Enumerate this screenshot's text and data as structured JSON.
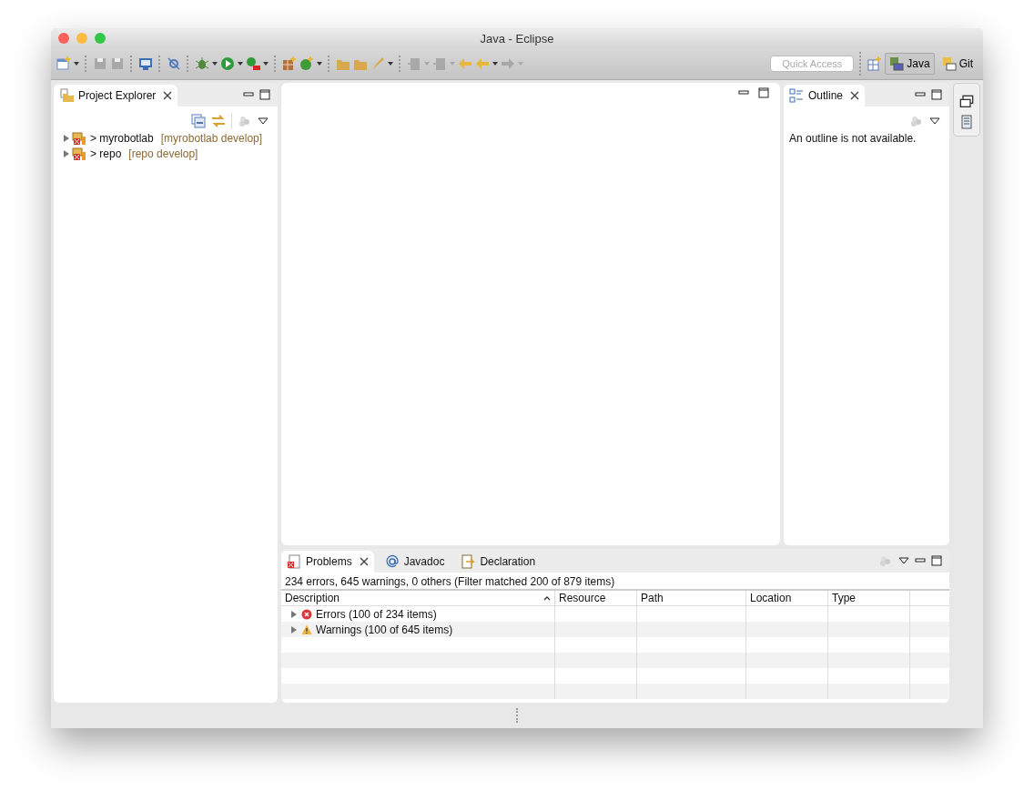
{
  "window": {
    "title": "Java - Eclipse"
  },
  "toolbar": {
    "quick_access": {
      "placeholder": "Quick Access"
    },
    "perspectives": [
      {
        "label": "Java",
        "selected": true
      },
      {
        "label": "Git",
        "selected": false
      }
    ]
  },
  "project_explorer": {
    "tab": {
      "label": "Project Explorer",
      "selected": true
    },
    "tree": [
      {
        "marker": ">",
        "name": "myrobotlab",
        "branch": "[myrobotlab develop]",
        "expanded": false
      },
      {
        "marker": ">",
        "name": "repo",
        "branch": "[repo develop]",
        "expanded": false
      }
    ]
  },
  "outline": {
    "tab": {
      "label": "Outline",
      "selected": true
    },
    "message": "An outline is not available."
  },
  "problems": {
    "tabs": [
      {
        "label": "Problems",
        "kind": "problems",
        "selected": true
      },
      {
        "label": "Javadoc",
        "kind": "javadoc",
        "selected": false
      },
      {
        "label": "Declaration",
        "kind": "declaration",
        "selected": false
      }
    ],
    "summary": "234 errors, 645 warnings, 0 others (Filter matched 200 of 879 items)",
    "columns": [
      "Description",
      "Resource",
      "Path",
      "Location",
      "Type"
    ],
    "rows": [
      {
        "kind": "error",
        "label": "Errors (100 of 234 items)",
        "expanded": false
      },
      {
        "kind": "warning",
        "label": "Warnings (100 of 645 items)",
        "expanded": false
      }
    ]
  }
}
